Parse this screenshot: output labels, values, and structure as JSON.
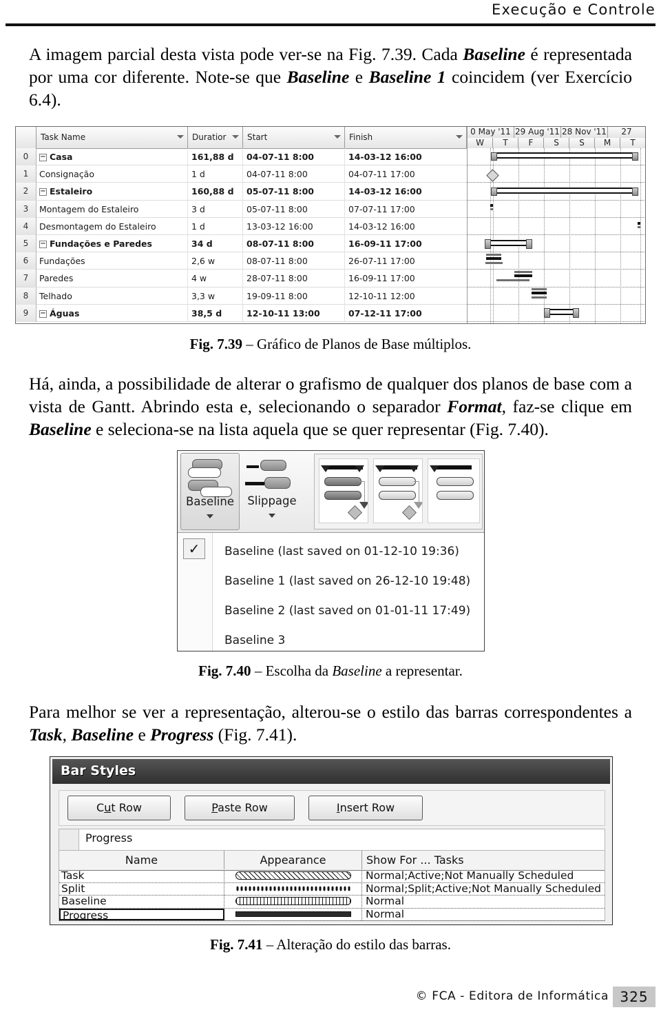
{
  "header": {
    "running_title": "Execução e Controle"
  },
  "body": {
    "para1_html": "A imagem parcial desta vista pode ver-se na Fig. 7.39. Cada <b>Baseline</b> é representada por uma cor diferente. Note-se que <b>Baseline</b> e <b>Baseline 1</b> coincidem (ver Exercício 6.4).",
    "para2_html": "Há, ainda, a possibilidade de alterar o grafismo de qualquer dos planos de base com a vista de Gantt. Abrindo esta e, selecionando o separador <b>Format</b>, faz-se clique em <b>Baseline</b> e seleciona-se na lista aquela que se quer representar (Fig. 7.40).",
    "para3_html": "Para melhor se ver a representação, alterou-se o estilo das barras correspondentes a <b>Task</b>, <b>Baseline</b> e <b>Progress</b> (Fig. 7.41)."
  },
  "captions": {
    "fig739_html": "<span class=\"fignum\">Fig. 7.39</span> &ndash; Gráfico de Planos de Base múltiplos.",
    "fig740_html": "<span class=\"fignum\">Fig. 7.40</span> &ndash; Escolha da <span class=\"it\">Baseline</span> a representar.",
    "fig741_html": "<span class=\"fignum\">Fig. 7.41</span> &ndash; Alteração do estilo das barras."
  },
  "gantt": {
    "columns": [
      {
        "key": "id",
        "label": ""
      },
      {
        "key": "name",
        "label": "Task Name"
      },
      {
        "key": "duration",
        "label": "Duratior"
      },
      {
        "key": "start",
        "label": "Start"
      },
      {
        "key": "finish",
        "label": "Finish"
      }
    ],
    "rows": [
      {
        "id": "0",
        "name": "Casa",
        "indent": 0,
        "outline": "-",
        "duration": "161,88 d",
        "start": "04-07-11 8:00",
        "finish": "14-03-12 16:00",
        "bold": true
      },
      {
        "id": "1",
        "name": "Consignação",
        "indent": 1,
        "outline": "",
        "duration": "1 d",
        "start": "04-07-11 8:00",
        "finish": "04-07-11 17:00",
        "bold": false
      },
      {
        "id": "2",
        "name": "Estaleiro",
        "indent": 1,
        "outline": "-",
        "duration": "160,88 d",
        "start": "05-07-11 8:00",
        "finish": "14-03-12 16:00",
        "bold": true
      },
      {
        "id": "3",
        "name": "Montagem do Estaleiro",
        "indent": 2,
        "outline": "",
        "duration": "3 d",
        "start": "05-07-11 8:00",
        "finish": "07-07-11 17:00",
        "bold": false
      },
      {
        "id": "4",
        "name": "Desmontagem do Estaleiro",
        "indent": 2,
        "outline": "",
        "duration": "1 d",
        "start": "13-03-12 16:00",
        "finish": "14-03-12 16:00",
        "bold": false
      },
      {
        "id": "5",
        "name": "Fundações e Paredes",
        "indent": 1,
        "outline": "-",
        "duration": "34 d",
        "start": "08-07-11 8:00",
        "finish": "16-09-11 17:00",
        "bold": true
      },
      {
        "id": "6",
        "name": "Fundações",
        "indent": 2,
        "outline": "",
        "duration": "2,6 w",
        "start": "08-07-11 8:00",
        "finish": "26-07-11 17:00",
        "bold": false
      },
      {
        "id": "7",
        "name": "Paredes",
        "indent": 2,
        "outline": "",
        "duration": "4 w",
        "start": "28-07-11 8:00",
        "finish": "16-09-11 17:00",
        "bold": false
      },
      {
        "id": "8",
        "name": "Telhado",
        "indent": 1,
        "outline": "",
        "duration": "3,3 w",
        "start": "19-09-11 8:00",
        "finish": "12-10-11 12:00",
        "bold": false
      },
      {
        "id": "9",
        "name": "Águas",
        "indent": 1,
        "outline": "-",
        "duration": "38,5 d",
        "start": "12-10-11 13:00",
        "finish": "07-12-11 17:00",
        "bold": true
      }
    ],
    "timescale_major": [
      "0 May '11",
      "29 Aug '11",
      "28 Nov '11",
      "27"
    ],
    "timescale_minor": [
      "W",
      "T",
      "F",
      "S",
      "S",
      "M",
      "T"
    ]
  },
  "fig740": {
    "ribbon": {
      "baseline_label": "Baseline",
      "slippage_label": "Slippage"
    },
    "dropdown": {
      "checked_index": 0,
      "items": [
        "Baseline (last saved on 01-12-10 19:36)",
        "Baseline 1 (last saved on 26-12-10 19:48)",
        "Baseline 2 (last saved on 01-01-11 17:49)",
        "Baseline 3"
      ]
    }
  },
  "fig741": {
    "title": "Bar Styles",
    "buttons": [
      {
        "pre": "C",
        "accel": "u",
        "post": "t Row"
      },
      {
        "pre": "",
        "accel": "P",
        "post": "aste Row"
      },
      {
        "pre": "",
        "accel": "I",
        "post": "nsert Row"
      }
    ],
    "edit_value": "Progress",
    "grid_headers": [
      "Name",
      "Appearance",
      "Show For ... Tasks"
    ],
    "grid_rows": [
      {
        "name": "Task",
        "appearance": "hatch",
        "show_for": "Normal;Active;Not Manually Scheduled",
        "selected": false
      },
      {
        "name": "Split",
        "appearance": "dots",
        "show_for": "Normal;Split;Active;Not Manually Scheduled",
        "selected": false
      },
      {
        "name": "Baseline",
        "appearance": "hollow",
        "show_for": "Normal",
        "selected": false
      },
      {
        "name": "Progress",
        "appearance": "solid",
        "show_for": "Normal",
        "selected": true
      }
    ]
  },
  "footer": {
    "copyright": "© FCA - Editora de Informática",
    "page_number": "325"
  }
}
